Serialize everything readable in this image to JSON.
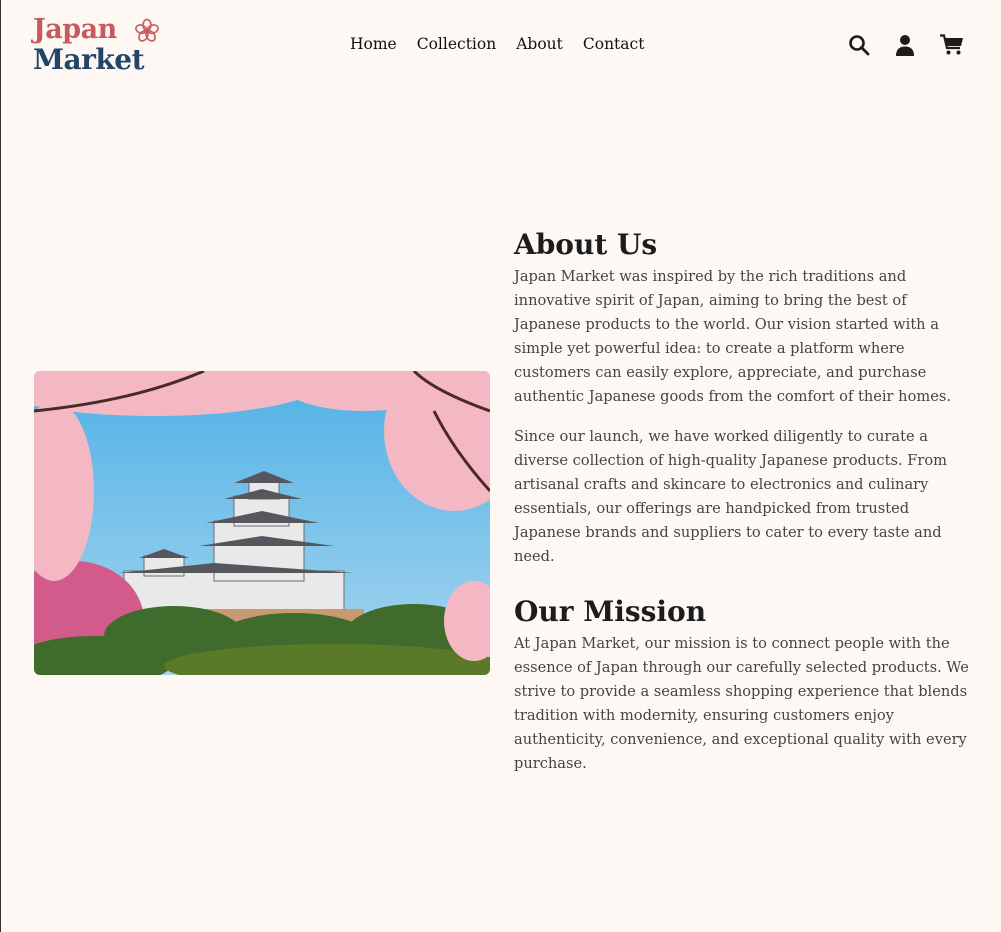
{
  "logo": {
    "line1": "Japan",
    "line2": "Market"
  },
  "nav": [
    "Home",
    "Collection",
    "About",
    "Contact"
  ],
  "icons": [
    "search-icon",
    "user-icon",
    "cart-icon"
  ],
  "image": {
    "alt": "Himeji castle with cherry blossoms"
  },
  "about": {
    "title": "About Us",
    "paragraphs": [
      "Japan Market was inspired by the rich traditions and innovative spirit of Japan, aiming to bring the best of Japanese products to the world. Our vision started with a simple yet powerful idea: to create a platform where customers can easily explore, appreciate, and purchase authentic Japanese goods from the comfort of their homes.",
      "Since our launch, we have worked diligently to curate a diverse collection of high-quality Japanese products. From artisanal crafts and skincare to electronics and culinary essentials, our offerings are handpicked from trusted Japanese brands and suppliers to cater to every taste and need."
    ]
  },
  "mission": {
    "title": "Our Mission",
    "paragraph": "At Japan Market, our mission is to connect people with the essence of Japan through our carefully selected products. We strive to provide a seamless shopping experience that blends tradition with modernity, ensuring customers enjoy authenticity, convenience, and exceptional quality with every purchase."
  },
  "colors": {
    "background": "#fdf8f4",
    "brand_red": "#c85a5f",
    "brand_navy": "#234566"
  }
}
